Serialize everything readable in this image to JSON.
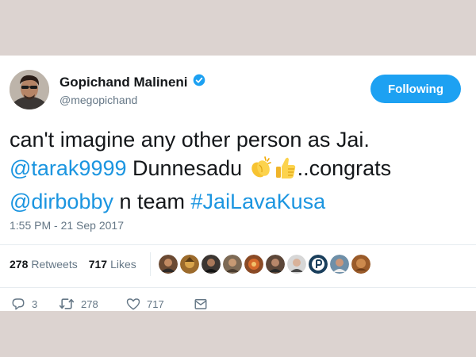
{
  "tweet": {
    "author_name": "Gopichand Malineni",
    "author_handle": "@megopichand",
    "follow_label": "Following",
    "text": {
      "line1": "can't imagine any other person as Jai.",
      "mention1": "@tarak9999",
      "word1": " Dunnesadu ",
      "after_emoji": "..congrats",
      "mention2": "@dirbobby",
      "middle": " n team ",
      "hashtag": "#JaiLavaKusa"
    },
    "timestamp": "1:55 PM - 21 Sep 2017",
    "retweets_count": "278",
    "retweets_label": "Retweets",
    "likes_count": "717",
    "likes_label": "Likes",
    "actions": {
      "replies": "3",
      "retweets": "278",
      "likes": "717"
    },
    "colors": {
      "accent": "#1da1f2",
      "link": "#1b95e0",
      "background": "#dcd3d0"
    },
    "icons": [
      "verified-badge-icon",
      "clapping-hands-emoji",
      "thumbs-up-emoji",
      "reply-icon",
      "retweet-icon",
      "like-icon",
      "direct-message-icon"
    ]
  }
}
